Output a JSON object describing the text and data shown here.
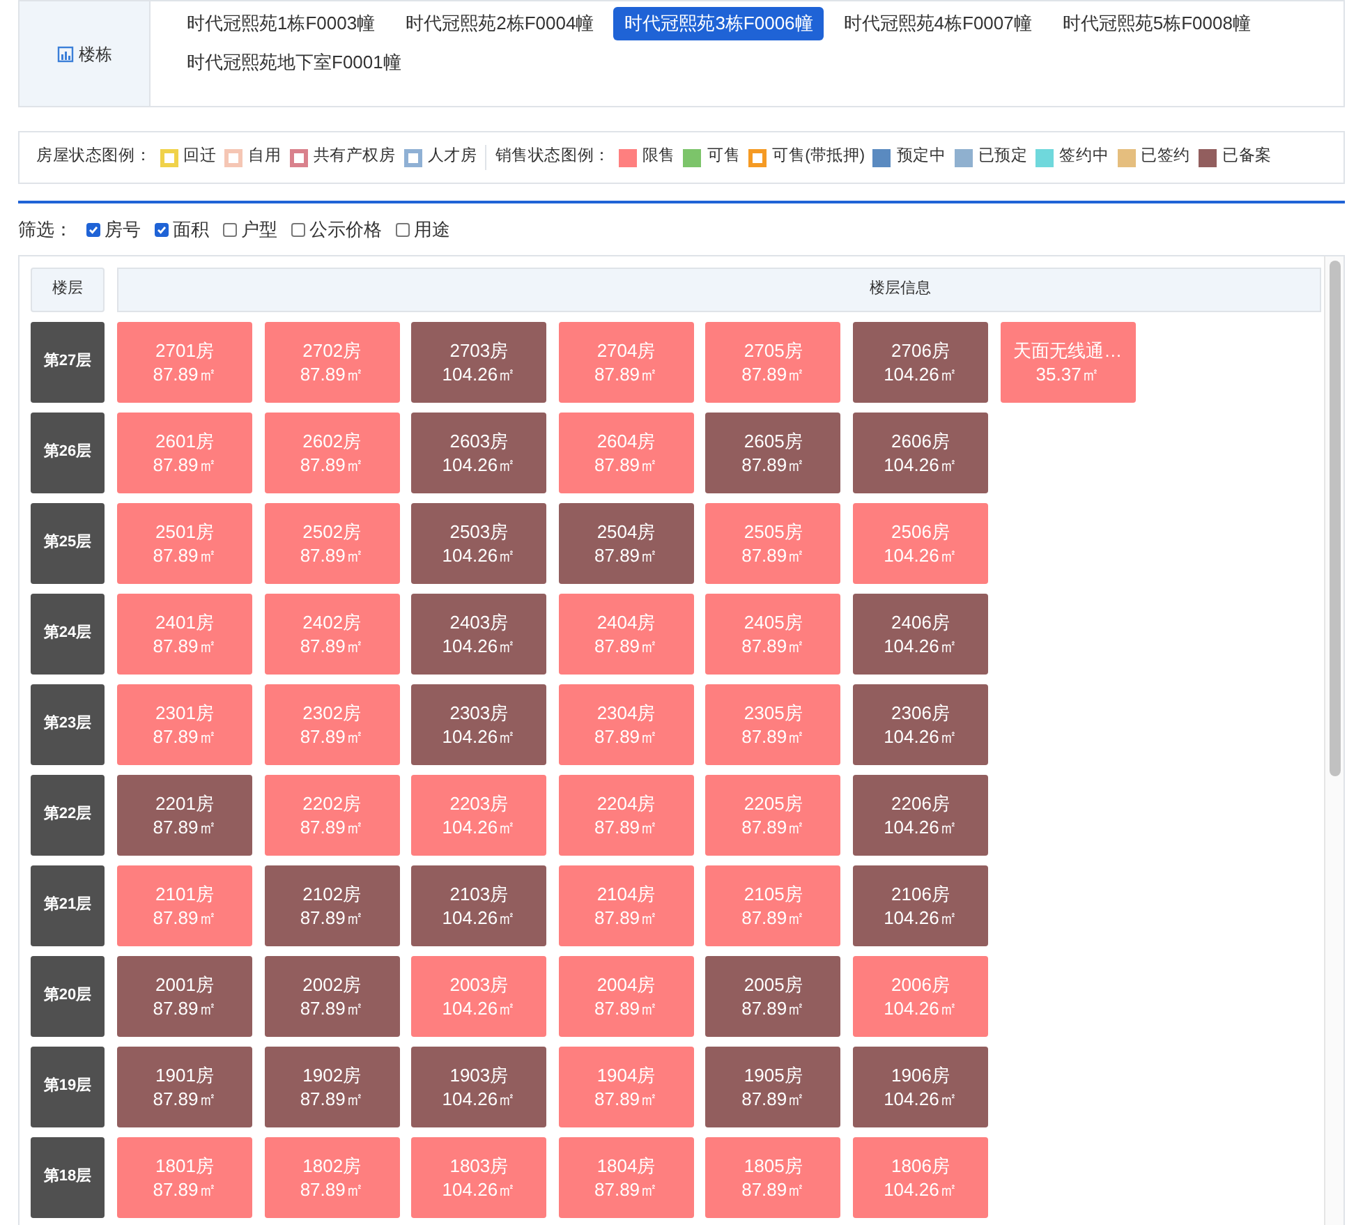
{
  "building_selector": {
    "label": "楼栋",
    "buildings": [
      {
        "name": "时代冠熙苑1栋F0003幢",
        "selected": false
      },
      {
        "name": "时代冠熙苑2栋F0004幢",
        "selected": false
      },
      {
        "name": "时代冠熙苑3栋F0006幢",
        "selected": true
      },
      {
        "name": "时代冠熙苑4栋F0007幢",
        "selected": false
      },
      {
        "name": "时代冠熙苑5栋F0008幢",
        "selected": false
      },
      {
        "name": "时代冠熙苑地下室F0001幢",
        "selected": false
      }
    ]
  },
  "legend": {
    "house_title": "房屋状态图例：",
    "house_items": [
      {
        "label": "回迁",
        "kind": "outline",
        "color": "#f0d24a"
      },
      {
        "label": "自用",
        "kind": "outline",
        "color": "#f5c6b4"
      },
      {
        "label": "共有产权房",
        "kind": "outline",
        "color": "#d9818c"
      },
      {
        "label": "人才房",
        "kind": "outline",
        "color": "#8fb0d4"
      }
    ],
    "sales_title": "销售状态图例：",
    "sales_items": [
      {
        "label": "限售",
        "kind": "fill",
        "color": "#fe7f7f"
      },
      {
        "label": "可售",
        "kind": "fill",
        "color": "#7cc46a"
      },
      {
        "label": "可售(带抵押)",
        "kind": "outline",
        "color": "#f59a23"
      },
      {
        "label": "预定中",
        "kind": "fill",
        "color": "#5a8ac0"
      },
      {
        "label": "已预定",
        "kind": "fill",
        "color": "#8fb0cf"
      },
      {
        "label": "签约中",
        "kind": "fill",
        "color": "#6fd8dc"
      },
      {
        "label": "已签约",
        "kind": "fill",
        "color": "#e5be7e"
      },
      {
        "label": "已备案",
        "kind": "fill",
        "color": "#925e5e"
      }
    ]
  },
  "filter": {
    "label": "筛选：",
    "options": [
      {
        "label": "房号",
        "checked": true
      },
      {
        "label": "面积",
        "checked": true
      },
      {
        "label": "户型",
        "checked": false
      },
      {
        "label": "公示价格",
        "checked": false
      },
      {
        "label": "用途",
        "checked": false
      }
    ]
  },
  "table": {
    "columns": [
      "楼层",
      "楼层信息"
    ],
    "floors": [
      {
        "floor": "第27层",
        "units": [
          {
            "room": "2701房",
            "area": "87.89㎡",
            "color": "#fe7f7f"
          },
          {
            "room": "2702房",
            "area": "87.89㎡",
            "color": "#fe7f7f"
          },
          {
            "room": "2703房",
            "area": "104.26㎡",
            "color": "#925e5e"
          },
          {
            "room": "2704房",
            "area": "87.89㎡",
            "color": "#fe7f7f"
          },
          {
            "room": "2705房",
            "area": "87.89㎡",
            "color": "#fe7f7f"
          },
          {
            "room": "2706房",
            "area": "104.26㎡",
            "color": "#925e5e"
          },
          {
            "room": "天面无线通…",
            "area": "35.37㎡",
            "color": "#fe7f7f"
          }
        ]
      },
      {
        "floor": "第26层",
        "units": [
          {
            "room": "2601房",
            "area": "87.89㎡",
            "color": "#fe7f7f"
          },
          {
            "room": "2602房",
            "area": "87.89㎡",
            "color": "#fe7f7f"
          },
          {
            "room": "2603房",
            "area": "104.26㎡",
            "color": "#925e5e"
          },
          {
            "room": "2604房",
            "area": "87.89㎡",
            "color": "#fe7f7f"
          },
          {
            "room": "2605房",
            "area": "87.89㎡",
            "color": "#925e5e"
          },
          {
            "room": "2606房",
            "area": "104.26㎡",
            "color": "#925e5e"
          }
        ]
      },
      {
        "floor": "第25层",
        "units": [
          {
            "room": "2501房",
            "area": "87.89㎡",
            "color": "#fe7f7f"
          },
          {
            "room": "2502房",
            "area": "87.89㎡",
            "color": "#fe7f7f"
          },
          {
            "room": "2503房",
            "area": "104.26㎡",
            "color": "#925e5e"
          },
          {
            "room": "2504房",
            "area": "87.89㎡",
            "color": "#925e5e"
          },
          {
            "room": "2505房",
            "area": "87.89㎡",
            "color": "#fe7f7f"
          },
          {
            "room": "2506房",
            "area": "104.26㎡",
            "color": "#fe7f7f"
          }
        ]
      },
      {
        "floor": "第24层",
        "units": [
          {
            "room": "2401房",
            "area": "87.89㎡",
            "color": "#fe7f7f"
          },
          {
            "room": "2402房",
            "area": "87.89㎡",
            "color": "#fe7f7f"
          },
          {
            "room": "2403房",
            "area": "104.26㎡",
            "color": "#925e5e"
          },
          {
            "room": "2404房",
            "area": "87.89㎡",
            "color": "#fe7f7f"
          },
          {
            "room": "2405房",
            "area": "87.89㎡",
            "color": "#fe7f7f"
          },
          {
            "room": "2406房",
            "area": "104.26㎡",
            "color": "#925e5e"
          }
        ]
      },
      {
        "floor": "第23层",
        "units": [
          {
            "room": "2301房",
            "area": "87.89㎡",
            "color": "#fe7f7f"
          },
          {
            "room": "2302房",
            "area": "87.89㎡",
            "color": "#fe7f7f"
          },
          {
            "room": "2303房",
            "area": "104.26㎡",
            "color": "#925e5e"
          },
          {
            "room": "2304房",
            "area": "87.89㎡",
            "color": "#fe7f7f"
          },
          {
            "room": "2305房",
            "area": "87.89㎡",
            "color": "#fe7f7f"
          },
          {
            "room": "2306房",
            "area": "104.26㎡",
            "color": "#925e5e"
          }
        ]
      },
      {
        "floor": "第22层",
        "units": [
          {
            "room": "2201房",
            "area": "87.89㎡",
            "color": "#925e5e"
          },
          {
            "room": "2202房",
            "area": "87.89㎡",
            "color": "#fe7f7f"
          },
          {
            "room": "2203房",
            "area": "104.26㎡",
            "color": "#fe7f7f"
          },
          {
            "room": "2204房",
            "area": "87.89㎡",
            "color": "#fe7f7f"
          },
          {
            "room": "2205房",
            "area": "87.89㎡",
            "color": "#fe7f7f"
          },
          {
            "room": "2206房",
            "area": "104.26㎡",
            "color": "#925e5e"
          }
        ]
      },
      {
        "floor": "第21层",
        "units": [
          {
            "room": "2101房",
            "area": "87.89㎡",
            "color": "#fe7f7f"
          },
          {
            "room": "2102房",
            "area": "87.89㎡",
            "color": "#925e5e"
          },
          {
            "room": "2103房",
            "area": "104.26㎡",
            "color": "#925e5e"
          },
          {
            "room": "2104房",
            "area": "87.89㎡",
            "color": "#fe7f7f"
          },
          {
            "room": "2105房",
            "area": "87.89㎡",
            "color": "#fe7f7f"
          },
          {
            "room": "2106房",
            "area": "104.26㎡",
            "color": "#925e5e"
          }
        ]
      },
      {
        "floor": "第20层",
        "units": [
          {
            "room": "2001房",
            "area": "87.89㎡",
            "color": "#925e5e"
          },
          {
            "room": "2002房",
            "area": "87.89㎡",
            "color": "#925e5e"
          },
          {
            "room": "2003房",
            "area": "104.26㎡",
            "color": "#fe7f7f"
          },
          {
            "room": "2004房",
            "area": "87.89㎡",
            "color": "#fe7f7f"
          },
          {
            "room": "2005房",
            "area": "87.89㎡",
            "color": "#925e5e"
          },
          {
            "room": "2006房",
            "area": "104.26㎡",
            "color": "#fe7f7f"
          }
        ]
      },
      {
        "floor": "第19层",
        "units": [
          {
            "room": "1901房",
            "area": "87.89㎡",
            "color": "#925e5e"
          },
          {
            "room": "1902房",
            "area": "87.89㎡",
            "color": "#925e5e"
          },
          {
            "room": "1903房",
            "area": "104.26㎡",
            "color": "#925e5e"
          },
          {
            "room": "1904房",
            "area": "87.89㎡",
            "color": "#fe7f7f"
          },
          {
            "room": "1905房",
            "area": "87.89㎡",
            "color": "#925e5e"
          },
          {
            "room": "1906房",
            "area": "104.26㎡",
            "color": "#925e5e"
          }
        ]
      },
      {
        "floor": "第18层",
        "units": [
          {
            "room": "1801房",
            "area": "87.89㎡",
            "color": "#fe7f7f"
          },
          {
            "room": "1802房",
            "area": "87.89㎡",
            "color": "#fe7f7f"
          },
          {
            "room": "1803房",
            "area": "104.26㎡",
            "color": "#fe7f7f"
          },
          {
            "room": "1804房",
            "area": "87.89㎡",
            "color": "#fe7f7f"
          },
          {
            "room": "1805房",
            "area": "87.89㎡",
            "color": "#fe7f7f"
          },
          {
            "room": "1806房",
            "area": "104.26㎡",
            "color": "#fe7f7f"
          }
        ]
      }
    ]
  }
}
